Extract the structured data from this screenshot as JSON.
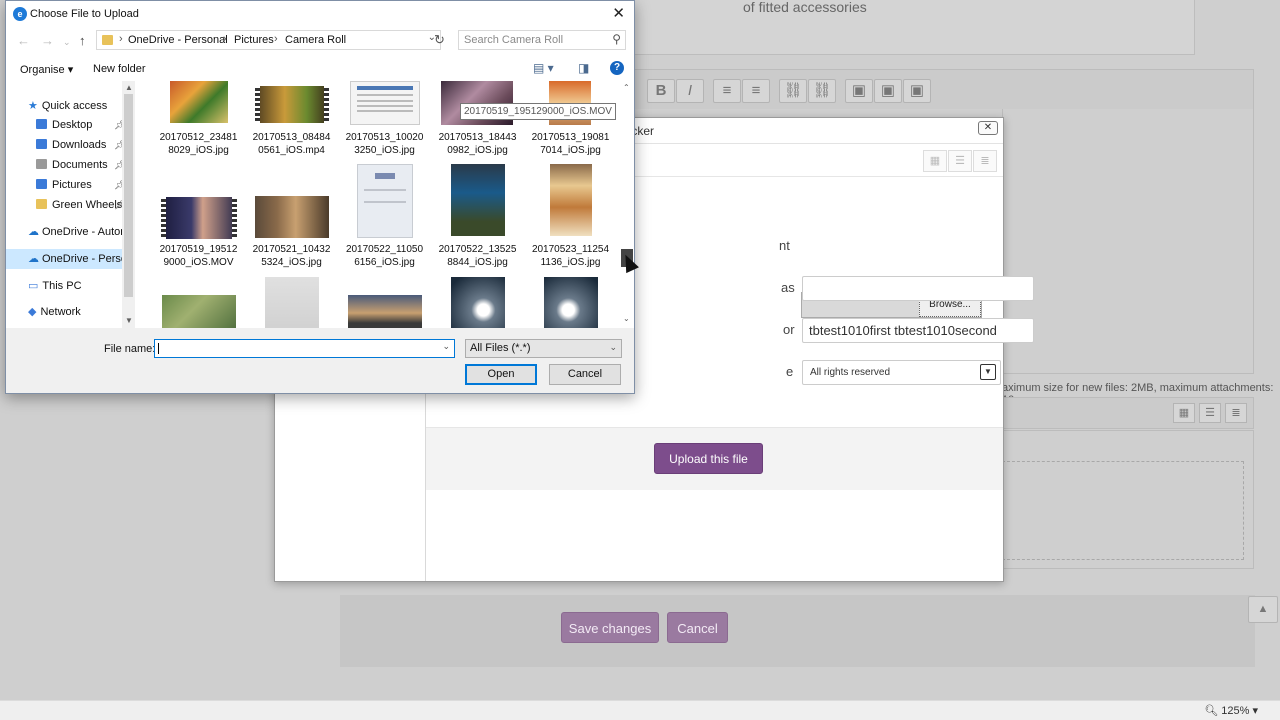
{
  "background": {
    "textarea_fragment": "of fitted accessories",
    "toolbar_icons": [
      "B",
      "I",
      "≡",
      "≡",
      "⛓",
      "⛓",
      "▣",
      "▣",
      "▣"
    ],
    "maxsize_text": "aximum size for new files: 2MB, maximum attachments: 10",
    "save_changes_label": "Save changes",
    "cancel_label": "Cancel",
    "zoom": "125%"
  },
  "modal": {
    "title": "picker",
    "close": "✕",
    "form": {
      "attachment_label_fragment": "nt",
      "browse_label": "Browse...",
      "saveas_label_fragment": "as",
      "author_label_fragment": "or",
      "author_value": "tbtest1010first tbtest1010second",
      "license_label_fragment": "e",
      "license_value": "All rights reserved"
    },
    "upload_label": "Upload this file"
  },
  "dialog": {
    "title": "Choose File to Upload",
    "close": "✕",
    "breadcrumbs": [
      "OneDrive - Personal",
      "Pictures",
      "Camera Roll"
    ],
    "search_placeholder": "Search Camera Roll",
    "organise_label": "Organise ▾",
    "new_folder_label": "New folder",
    "nav": {
      "quick_access": "Quick access",
      "items": [
        {
          "label": "Desktop",
          "color": "#3b7ad8"
        },
        {
          "label": "Downloads",
          "color": "#3b7ad8"
        },
        {
          "label": "Documents",
          "color": "#8a8a8a"
        },
        {
          "label": "Pictures",
          "color": "#3b7ad8"
        },
        {
          "label": "Green Wheels",
          "color": "#e8c25a"
        }
      ],
      "onedrive_auto": "OneDrive - Autom",
      "onedrive_personal": "OneDrive - Person",
      "this_pc": "This PC",
      "network": "Network"
    },
    "files": [
      {
        "line1": "20170512_23481",
        "line2": "8029_iOS.jpg",
        "video": false
      },
      {
        "line1": "20170513_08484",
        "line2": "0561_iOS.mp4",
        "video": true
      },
      {
        "line1": "20170513_10020",
        "line2": "3250_iOS.jpg",
        "video": false
      },
      {
        "line1": "20170513_18443",
        "line2": "0982_iOS.jpg",
        "video": false
      },
      {
        "line1": "20170513_19081",
        "line2": "7014_iOS.jpg",
        "video": false
      },
      {
        "line1": "20170519_19512",
        "line2": "9000_iOS.MOV",
        "video": true
      },
      {
        "line1": "20170521_10432",
        "line2": "5324_iOS.jpg",
        "video": false
      },
      {
        "line1": "20170522_11050",
        "line2": "6156_iOS.jpg",
        "video": false
      },
      {
        "line1": "20170522_13525",
        "line2": "8844_iOS.jpg",
        "video": false
      },
      {
        "line1": "20170523_11254",
        "line2": "1136_iOS.jpg",
        "video": false
      }
    ],
    "tooltip": "20170519_195129000_iOS.MOV",
    "file_name_label": "File name:",
    "file_name_value": "",
    "filter_value": "All Files (*.*)",
    "open_label": "Open",
    "cancel_label": "Cancel"
  }
}
